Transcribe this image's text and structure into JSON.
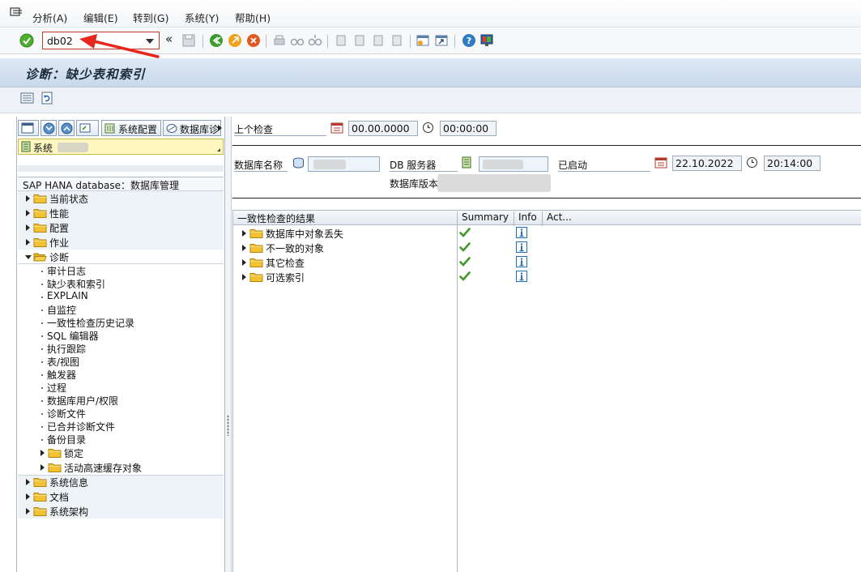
{
  "menu": {
    "items": [
      "分析(A)",
      "编辑(E)",
      "转到(G)",
      "系统(Y)",
      "帮助(H)"
    ]
  },
  "toolbar": {
    "command_value": "db02",
    "nav_back_symbol": "«"
  },
  "title": "诊断：缺少表和索引",
  "left_panel": {
    "buttons": {
      "sys_config": "系统配置",
      "db_label": "数据库诊"
    },
    "system_label": "系统",
    "tree_header": "SAP HANA database：数据库管理",
    "tree": [
      {
        "label": "当前状态",
        "type": "folder"
      },
      {
        "label": "性能",
        "type": "folder"
      },
      {
        "label": "配置",
        "type": "folder"
      },
      {
        "label": "作业",
        "type": "folder"
      },
      {
        "label": "诊断",
        "type": "folder-open"
      },
      {
        "label": "审计日志",
        "type": "leaf"
      },
      {
        "label": "缺少表和索引",
        "type": "leaf"
      },
      {
        "label": "EXPLAIN",
        "type": "leaf"
      },
      {
        "label": "自监控",
        "type": "leaf"
      },
      {
        "label": "一致性检查历史记录",
        "type": "leaf"
      },
      {
        "label": "SQL 编辑器",
        "type": "leaf"
      },
      {
        "label": "执行跟踪",
        "type": "leaf"
      },
      {
        "label": "表/视图",
        "type": "leaf"
      },
      {
        "label": "触发器",
        "type": "leaf"
      },
      {
        "label": "过程",
        "type": "leaf"
      },
      {
        "label": "数据库用户/权限",
        "type": "leaf"
      },
      {
        "label": "诊断文件",
        "type": "leaf"
      },
      {
        "label": "已合并诊断文件",
        "type": "leaf"
      },
      {
        "label": "备份目录",
        "type": "leaf"
      },
      {
        "label": "锁定",
        "type": "subfolder"
      },
      {
        "label": "活动高速缓存对象",
        "type": "subfolder"
      },
      {
        "label": "系统信息",
        "type": "folder"
      },
      {
        "label": "文档",
        "type": "folder"
      },
      {
        "label": "系统架构",
        "type": "folder"
      }
    ]
  },
  "header_info": {
    "last_check_label": "上个检查",
    "last_check_date": "00.00.0000",
    "last_check_time": "00:00:00",
    "db_name_label": "数据库名称",
    "db_server_label": "DB 服务器",
    "started_label": "已启动",
    "started_date": "22.10.2022",
    "started_time": "20:14:00",
    "db_version_label": "数据库版本"
  },
  "results": {
    "columns": [
      "一致性检查的结果",
      "Summary",
      "Info",
      "Act..."
    ],
    "rows": [
      {
        "label": "数据库中对象丢失",
        "summary": "ok"
      },
      {
        "label": "不一致的对象",
        "summary": "ok"
      },
      {
        "label": "其它检查",
        "summary": "ok"
      },
      {
        "label": "可选索引",
        "summary": "ok"
      }
    ]
  },
  "colors": {
    "title_bg": "#c9d8ea",
    "accent_red": "#c0392b",
    "check_green": "#3f9a2a",
    "folder_yellow": "#f3c232",
    "info_blue": "#1f6fb7"
  }
}
